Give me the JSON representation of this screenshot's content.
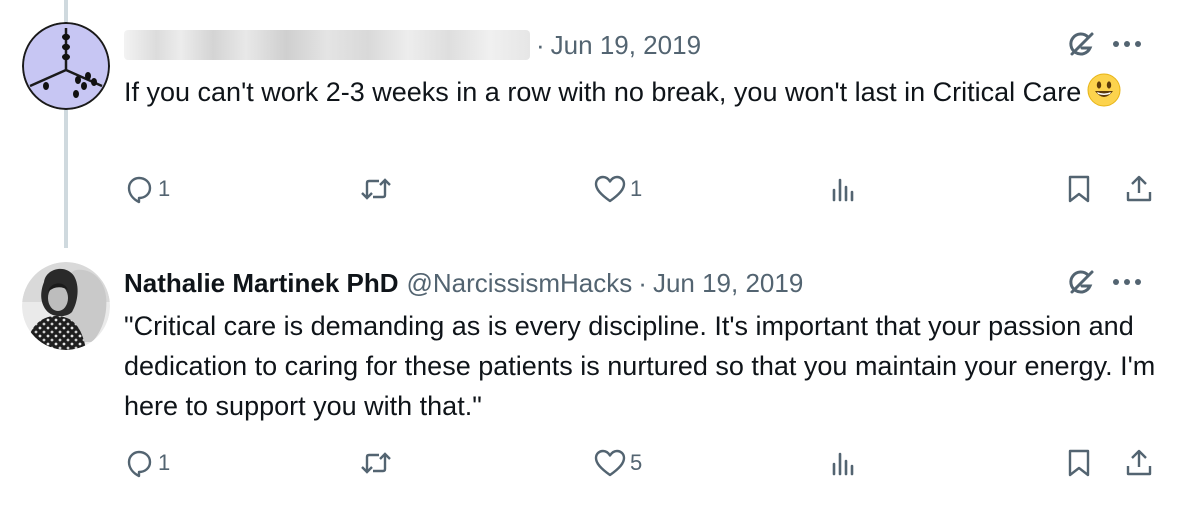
{
  "tweets": [
    {
      "author_name": "",
      "author_handle": "",
      "separator": "·",
      "date": "Jun 19, 2019",
      "text": "If you can't work 2-3 weeks in a row with no break, you won't last in Critical Care",
      "emoji": "grinning-face",
      "replies": "1",
      "retweets": "",
      "likes": "1",
      "views": ""
    },
    {
      "author_name": "Nathalie Martinek PhD",
      "author_handle": "@NarcissismHacks",
      "separator": "·",
      "date": "Jun 19, 2019",
      "text": "\"Critical care is demanding as is every discipline. It's important that your passion and dedication to caring for these patients is nurtured so that you maintain your energy. I'm here to support you with that.\"",
      "replies": "1",
      "retweets": "",
      "likes": "5",
      "views": ""
    }
  ],
  "icons": {
    "reply": "reply-icon",
    "retweet": "retweet-icon",
    "like": "heart-icon",
    "views": "views-icon",
    "bookmark": "bookmark-icon",
    "share": "share-icon",
    "grok": "grok-icon",
    "more": "more-icon"
  },
  "colors": {
    "text": "#0f1419",
    "secondary": "#536471",
    "thread_line": "#cfd9de",
    "avatar_dice": "#c7c6f3"
  }
}
